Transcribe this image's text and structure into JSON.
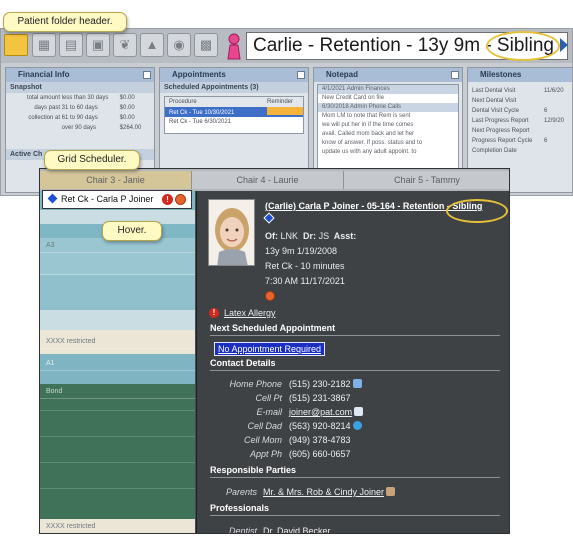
{
  "callouts": {
    "folder_header": "Patient folder header.",
    "grid_scheduler": "Grid Scheduler.",
    "hover": "Hover."
  },
  "top": {
    "folder_header_text": "Carlie - Retention - 13y 9m - Sibling",
    "toolbar_icons": [
      "folder-icon",
      "grid-icon",
      "list-icon",
      "calendar-icon",
      "tooth-icon",
      "tree-icon",
      "photos-icon",
      "printer-icon",
      "patient-icon"
    ],
    "panels": [
      {
        "title": "Financial Info",
        "subtitle": "Snapshot",
        "rows": [
          [
            "total amount",
            "less than 30 days",
            "$0.00"
          ],
          [
            "days past",
            "31 to 60 days",
            "$0.00"
          ],
          [
            "collection at",
            "61 to 90 days",
            "$0.00"
          ],
          [
            "",
            "over 90 days",
            "$264.00"
          ]
        ]
      },
      {
        "title": "Appointments",
        "subtitle": "Scheduled Appointments (3)",
        "rows": [
          [
            "Procedure",
            "Reminder"
          ],
          [
            "Ret Ck - Tue 10/30/2021",
            ""
          ],
          [
            "Ret Ck - Tue 6/30/2021",
            ""
          ]
        ]
      },
      {
        "title": "Notepad",
        "subtitle": "",
        "rows": [
          [
            "4/1/2021 Admin Finances"
          ],
          [
            "New Credit Card on file"
          ],
          [
            "6/30/2018 Admin Phone Calls"
          ],
          [
            "Mom LM to note that Rem is sent"
          ],
          [
            "we will put her in if the time comes"
          ],
          [
            "avail. Called mom back and let her"
          ],
          [
            "know of answer. If poss. status and to"
          ],
          [
            "update us with any adult appoint. to"
          ]
        ]
      },
      {
        "title": "Milestones",
        "subtitle": "",
        "rows": [
          [
            "Last Dental Visit",
            "11/6/20"
          ],
          [
            "Next Dental Visit",
            ""
          ],
          [
            "Dental Visit Cycle",
            "6"
          ],
          [
            "Last Progress Report",
            "12/9/20"
          ],
          [
            "Next Progress Report",
            ""
          ],
          [
            "Progress Report Cycle",
            "6"
          ],
          [
            "Completion Date",
            ""
          ]
        ]
      }
    ],
    "bottom_label": "Active Ch"
  },
  "scheduler": {
    "chairs": [
      "Chair 3 - Janie",
      "Chair 4 - Laurie",
      "Chair 5 - Tammy"
    ],
    "appointment_label": "Ret Ck - Carla P Joiner",
    "slots": [
      "A3",
      "XXXX      restricted",
      "A1",
      "Bond",
      "XXXX      restricted"
    ]
  },
  "popup": {
    "name_line": "(Carlie) Carla P Joiner - 05-164 - Retention - Sibling",
    "office_line_prefix": "Of:",
    "office": "LNK",
    "doctor_prefix": "Dr:",
    "doctor": "JS",
    "asst_prefix": "Asst:",
    "age_dob": "13y 9m  1/19/2008",
    "appt_type": "Ret Ck - 10 minutes",
    "appt_time": "7:30 AM 11/17/2021",
    "medical_alert": "Latex Allergy",
    "next_appt_heading": "Next Scheduled Appointment",
    "next_appt": "No Appointment Required",
    "contact_heading": "Contact Details",
    "contacts": [
      {
        "label": "Home Phone",
        "value": "(515) 230-2182",
        "icon": "phone-icon"
      },
      {
        "label": "Cell Pt",
        "value": "(515) 231-3867",
        "icon": ""
      },
      {
        "label": "E-mail",
        "value": "joiner@pat.com",
        "icon": "email-icon"
      },
      {
        "label": "Cell Dad",
        "value": "(563) 920-8214",
        "icon": "text-message-icon"
      },
      {
        "label": "Cell Mom",
        "value": "(949) 378-4783",
        "icon": ""
      },
      {
        "label": "Appt Ph",
        "value": "(605) 660-0657",
        "icon": ""
      }
    ],
    "responsible_heading": "Responsible Parties",
    "parents_label": "Parents",
    "parents_value": "Mr. & Mrs. Rob & Cindy Joiner",
    "professionals_heading": "Professionals",
    "dentist_label": "Dentist",
    "dentist_value": "Dr. David Becker"
  },
  "colors": {
    "callout_bg": "#fff9c4",
    "highlight_ring": "#e6c13a",
    "popup_bg": "#3f4245",
    "appt_link_bg": "#1a2ec2",
    "grid_teal": "#7fb7c4"
  }
}
